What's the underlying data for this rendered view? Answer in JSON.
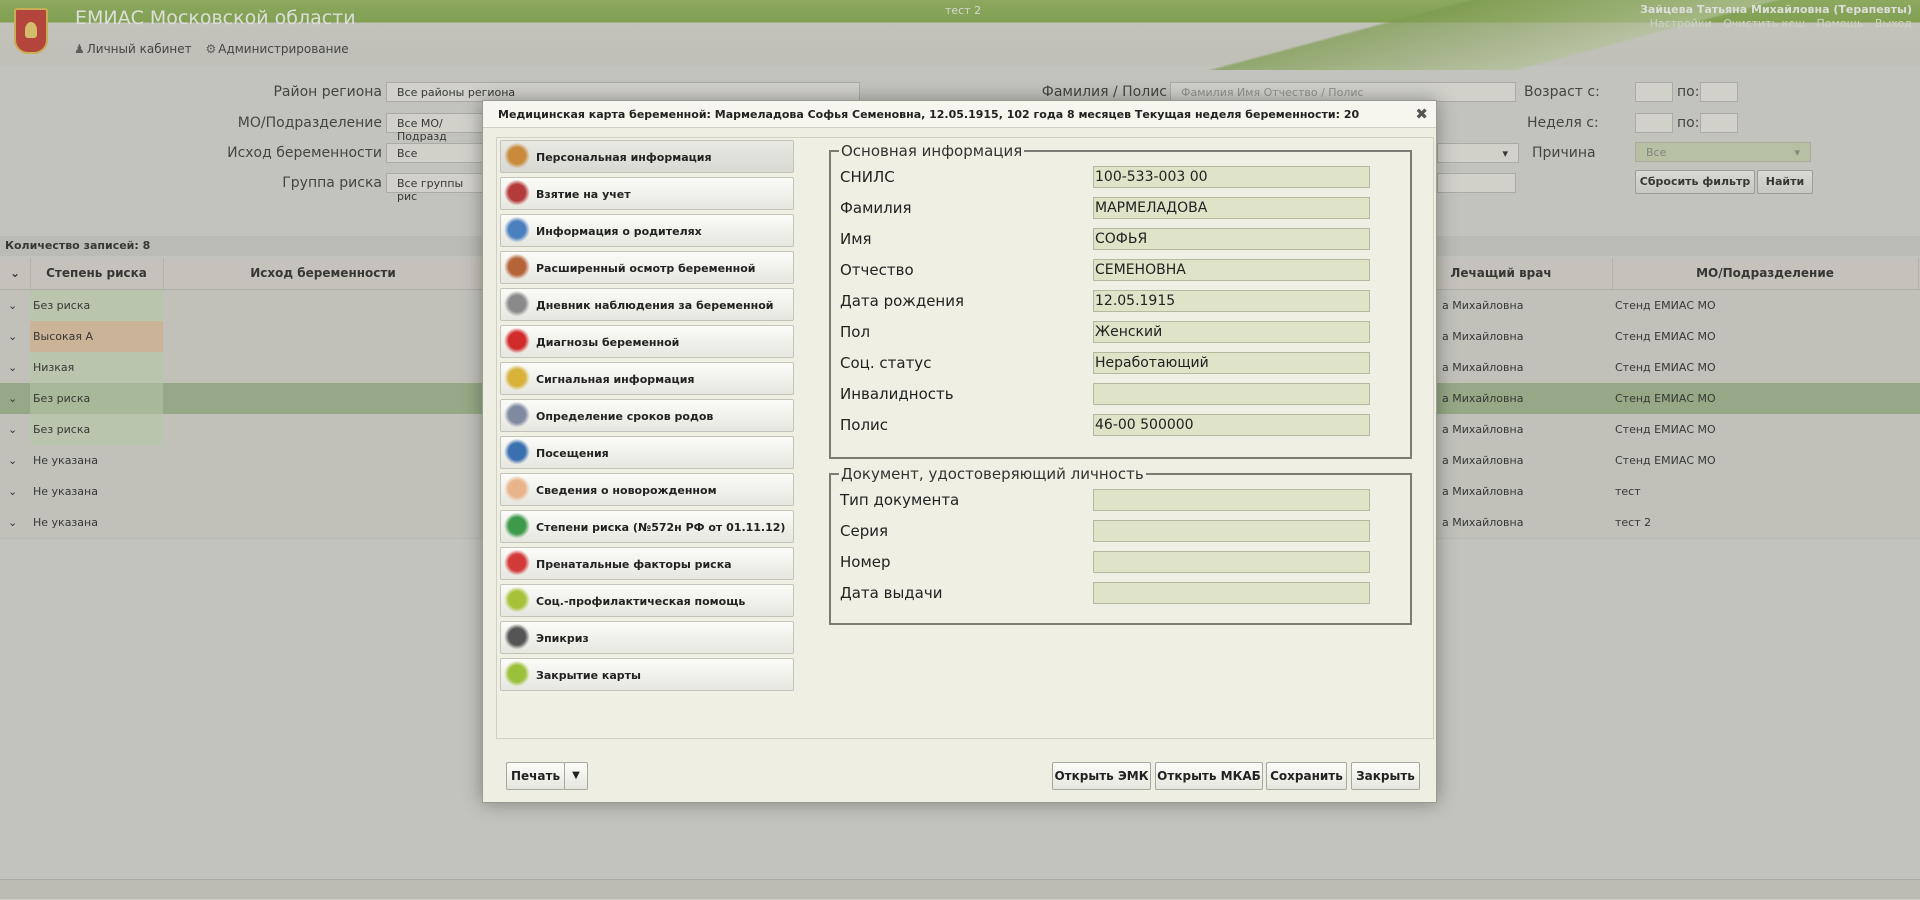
{
  "app": {
    "title": "ЕМИАС Московской области",
    "env": "тест 2",
    "user": "Зайцева Татьяна Михайловна (Терапевты)",
    "top_links": [
      "Настройки",
      "Очистить кеш",
      "Помощь",
      "Выход"
    ],
    "nav": [
      "Личный кабинет",
      "Администрирование"
    ]
  },
  "filters": {
    "district_label": "Район региона",
    "district_value": "Все районы региона",
    "mo_label": "МО/Подразделение",
    "mo_value": "Все МО/Подразд",
    "outcome_label": "Исход беременности",
    "outcome_value": "Все",
    "risk_group_label": "Группа риска",
    "risk_group_value": "Все группы рис",
    "name_label": "Фамилия / Полис",
    "name_placeholder": "Фамилия Имя Отчество / Полис",
    "age_from_label": "Возраст с:",
    "to_label": "по:",
    "week_from_label": "Неделя с:",
    "reason_label": "Причина",
    "reason_value": "Все",
    "reset_button": "Сбросить фильтр",
    "find_button": "Найти"
  },
  "grid": {
    "count": "Количество записей: 8",
    "columns": [
      "Степень риска",
      "Исход беременности",
      "Лечащий врач",
      "МО/Подразделение"
    ],
    "rows": [
      {
        "risk": "Без риска",
        "risk_color": "#cfe1c2",
        "doctor": "а Михайловна",
        "mo": "Стенд ЕМИАС МО"
      },
      {
        "risk": "Высокая А",
        "risk_color": "#e7c7a6",
        "doctor": "а Михайловна",
        "mo": "Стенд ЕМИАС МО"
      },
      {
        "risk": "Низкая",
        "risk_color": "#cfe1c2",
        "doctor": "а Михайловна",
        "mo": "Стенд ЕМИАС МО"
      },
      {
        "risk": "Без риска",
        "risk_color": "#b9cfa8",
        "doctor": "а Михайловна",
        "mo": "Стенд ЕМИАС МО"
      },
      {
        "risk": "Без риска",
        "risk_color": "#cfe1c2",
        "doctor": "а Михайловна",
        "mo": "Стенд ЕМИАС МО"
      },
      {
        "risk": "Не указана",
        "risk_color": "",
        "doctor": "а Михайловна",
        "mo": "Стенд ЕМИАС МО"
      },
      {
        "risk": "Не указана",
        "risk_color": "",
        "doctor": "а Михайловна",
        "mo": "тест"
      },
      {
        "risk": "Не указана",
        "risk_color": "",
        "doctor": "а Михайловна",
        "mo": "тест 2"
      }
    ]
  },
  "modal": {
    "title": "Медицинская карта беременной: Мармеладова Софья Семеновна,  12.05.1915, 102 года 8 месяцев Текущая неделя беременности: 20",
    "menu": [
      {
        "label": "Персональная информация",
        "icon": "person-icon",
        "color": "#c98a3c"
      },
      {
        "label": "Взятие на учет",
        "icon": "registration-icon",
        "color": "#b53a3a"
      },
      {
        "label": "Информация о родителях",
        "icon": "parents-icon",
        "color": "#4a7fc0"
      },
      {
        "label": "Расширенный осмотр беременной",
        "icon": "exam-icon",
        "color": "#b5643a"
      },
      {
        "label": "Дневник наблюдения за беременной",
        "icon": "diary-icon",
        "color": "#8a8a8a"
      },
      {
        "label": "Диагнозы беременной",
        "icon": "diagnosis-icon",
        "color": "#d22b2b"
      },
      {
        "label": "Сигнальная информация",
        "icon": "signal-icon",
        "color": "#d9b23a"
      },
      {
        "label": "Определение сроков родов",
        "icon": "calculator-icon",
        "color": "#7f8aa0"
      },
      {
        "label": "Посещения",
        "icon": "visits-icon",
        "color": "#3a6fb0"
      },
      {
        "label": "Сведения о новорожденном",
        "icon": "newborn-icon",
        "color": "#e8b48a"
      },
      {
        "label": "Степени риска (№572н РФ от 01.11.12)",
        "icon": "risk-icon",
        "color": "#3d9a4a"
      },
      {
        "label": "Пренатальные факторы риска",
        "icon": "prenatal-icon",
        "color": "#d23a3a"
      },
      {
        "label": "Соц.-профилактическая помощь",
        "icon": "social-help-icon",
        "color": "#a7c23a"
      },
      {
        "label": "Эпикриз",
        "icon": "epicrisis-icon",
        "color": "#555555"
      },
      {
        "label": "Закрытие карты",
        "icon": "close-card-icon",
        "color": "#9bc13a"
      }
    ],
    "basic": {
      "legend": "Основная информация",
      "fields": [
        {
          "label": "СНИЛС",
          "value": "100-533-003 00"
        },
        {
          "label": "Фамилия",
          "value": "МАРМЕЛАДОВА"
        },
        {
          "label": "Имя",
          "value": "СОФЬЯ"
        },
        {
          "label": "Отчество",
          "value": "СЕМЕНОВНА"
        },
        {
          "label": "Дата рождения",
          "value": "12.05.1915"
        },
        {
          "label": "Пол",
          "value": "Женский"
        },
        {
          "label": "Соц. статус",
          "value": "Неработающий"
        },
        {
          "label": "Инвалидность",
          "value": ""
        },
        {
          "label": "Полис",
          "value": "46-00 500000"
        }
      ]
    },
    "document": {
      "legend": "Документ, удостоверяющий личность",
      "fields": [
        {
          "label": "Тип документа",
          "value": ""
        },
        {
          "label": "Серия",
          "value": ""
        },
        {
          "label": "Номер",
          "value": ""
        },
        {
          "label": "Дата выдачи",
          "value": ""
        }
      ]
    },
    "footer": {
      "print": "Печать",
      "open_emk": "Открыть ЭМК",
      "open_mkab": "Открыть МКАБ",
      "save": "Сохранить",
      "close": "Закрыть"
    }
  }
}
